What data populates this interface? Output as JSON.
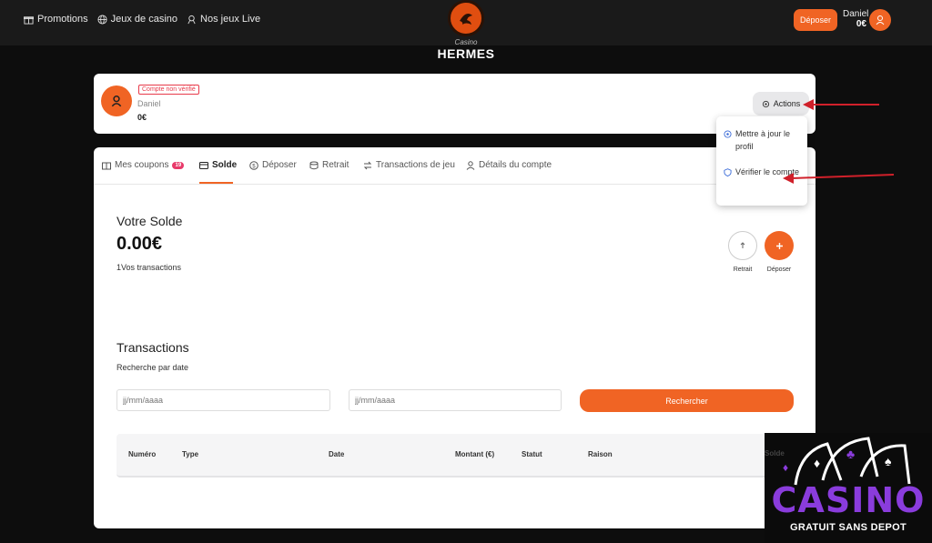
{
  "topnav": {
    "links": [
      {
        "label": "Promotions",
        "icon": "gift-icon"
      },
      {
        "label": "Jeux de casino",
        "icon": "globe-icon"
      },
      {
        "label": "Nos jeux Live",
        "icon": "live-dealer-icon"
      }
    ],
    "logo": {
      "casino": "Casino",
      "name": "HERMES"
    },
    "deposit_label": "Déposer",
    "user_name": "Daniel",
    "user_balance": "0€"
  },
  "profile": {
    "badge": "Compte non vérifié",
    "name": "Daniel",
    "balance": "0€",
    "actions_label": "Actions"
  },
  "actions_menu": {
    "items": [
      {
        "label": "Mettre à jour le profil",
        "icon": "settings-icon"
      },
      {
        "label": "Vérifier le compte",
        "icon": "shield-icon"
      }
    ]
  },
  "tabs": [
    {
      "label": "Mes coupons",
      "badge": "19",
      "icon": "coupon-icon"
    },
    {
      "label": "Solde",
      "icon": "wallet-icon",
      "active": true
    },
    {
      "label": "Déposer",
      "icon": "dollar-icon"
    },
    {
      "label": "Retrait",
      "icon": "coins-icon"
    },
    {
      "label": "Transactions de jeu",
      "icon": "exchange-icon"
    },
    {
      "label": "Détails du compte",
      "icon": "user-icon"
    }
  ],
  "balance": {
    "title": "Votre Solde",
    "amount": "0.00€",
    "subtitle": "1Vos transactions",
    "withdraw_label": "Retrait",
    "deposit_label": "Déposer"
  },
  "transactions": {
    "title": "Transactions",
    "subtitle": "Recherche par date",
    "date_placeholder_from": "jj/mm/aaaa",
    "date_placeholder_to": "jj/mm/aaaa",
    "search_label": "Rechercher",
    "columns": [
      "Numéro",
      "Type",
      "Date",
      "Montant (€)",
      "Statut",
      "Raison",
      "Solde"
    ]
  },
  "watermark": {
    "title": "CASINO",
    "subtitle": "GRATUIT SANS DEPOT"
  },
  "colors": {
    "accent": "#f06424",
    "badge_red": "#e83a4a",
    "watermark_purple": "#8a3cdc",
    "arrow_red": "#d0202a"
  }
}
